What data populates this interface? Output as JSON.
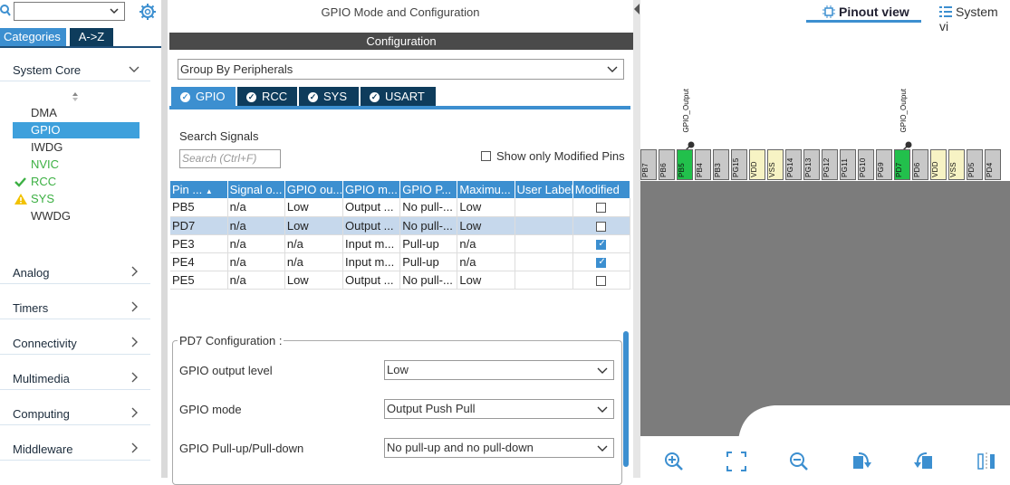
{
  "left": {
    "search_value": "",
    "tabs": {
      "categories": "Categories",
      "atoz": "A->Z"
    },
    "groups": [
      {
        "label": "System Core"
      },
      {
        "label": "Analog"
      },
      {
        "label": "Timers"
      },
      {
        "label": "Connectivity"
      },
      {
        "label": "Multimedia"
      },
      {
        "label": "Computing"
      },
      {
        "label": "Middleware"
      }
    ],
    "items": [
      {
        "label": "DMA",
        "status": "none"
      },
      {
        "label": "GPIO",
        "status": "selected"
      },
      {
        "label": "IWDG",
        "status": "none"
      },
      {
        "label": "NVIC",
        "status": "green"
      },
      {
        "label": "RCC",
        "status": "check"
      },
      {
        "label": "SYS",
        "status": "warning"
      },
      {
        "label": "WWDG",
        "status": "none"
      }
    ]
  },
  "middle": {
    "title": "GPIO Mode and Configuration",
    "config_header": "Configuration",
    "group_by": "Group By Peripherals",
    "periph_tabs": [
      "GPIO",
      "RCC",
      "SYS",
      "USART"
    ],
    "search_label": "Search Signals",
    "search_placeholder": "Search (Ctrl+F)",
    "show_modified": "Show only Modified Pins",
    "columns": [
      "Pin ...",
      "Signal o...",
      "GPIO ou...",
      "GPIO m...",
      "GPIO P...",
      "Maximu...",
      "User Label",
      "Modified"
    ],
    "rows": [
      {
        "pin": "PB5",
        "signal": "n/a",
        "out": "Low",
        "mode": "Output ...",
        "pull": "No pull-...",
        "max": "Low",
        "label": "",
        "modified": false
      },
      {
        "pin": "PD7",
        "signal": "n/a",
        "out": "Low",
        "mode": "Output ...",
        "pull": "No pull-...",
        "max": "Low",
        "label": "",
        "modified": false
      },
      {
        "pin": "PE3",
        "signal": "n/a",
        "out": "n/a",
        "mode": "Input m...",
        "pull": "Pull-up",
        "max": "n/a",
        "label": "",
        "modified": true
      },
      {
        "pin": "PE4",
        "signal": "n/a",
        "out": "n/a",
        "mode": "Input m...",
        "pull": "Pull-up",
        "max": "n/a",
        "label": "",
        "modified": true
      },
      {
        "pin": "PE5",
        "signal": "n/a",
        "out": "Low",
        "mode": "Output ...",
        "pull": "No pull-...",
        "max": "Low",
        "label": "",
        "modified": false
      }
    ],
    "pin_config_title": "PD7 Configuration :",
    "config_fields": [
      {
        "label": "GPIO output level",
        "value": "Low"
      },
      {
        "label": "GPIO mode",
        "value": "Output Push Pull"
      },
      {
        "label": "GPIO Pull-up/Pull-down",
        "value": "No pull-up and no pull-down"
      }
    ]
  },
  "right": {
    "tabs": {
      "pinout": "Pinout view",
      "system": "System vi"
    },
    "pins": [
      {
        "name": "PB7",
        "color": "gray"
      },
      {
        "name": "PB6",
        "color": "gray"
      },
      {
        "name": "PB5",
        "color": "green"
      },
      {
        "name": "PB4",
        "color": "gray"
      },
      {
        "name": "PB3",
        "color": "gray"
      },
      {
        "name": "PG15",
        "color": "gray"
      },
      {
        "name": "VDD",
        "color": "yellow"
      },
      {
        "name": "VSS",
        "color": "yellow"
      },
      {
        "name": "PG14",
        "color": "gray"
      },
      {
        "name": "PG13",
        "color": "gray"
      },
      {
        "name": "PG12",
        "color": "gray"
      },
      {
        "name": "PG11",
        "color": "gray"
      },
      {
        "name": "PG10",
        "color": "gray"
      },
      {
        "name": "PG9",
        "color": "gray"
      },
      {
        "name": "PD7",
        "color": "green"
      },
      {
        "name": "PD6",
        "color": "gray"
      },
      {
        "name": "VDD",
        "color": "yellow"
      },
      {
        "name": "VSS",
        "color": "yellow"
      },
      {
        "name": "PD5",
        "color": "gray"
      },
      {
        "name": "PD4",
        "color": "gray"
      }
    ],
    "pin_labels": [
      "GPIO_Output",
      "GPIO_Output"
    ]
  }
}
